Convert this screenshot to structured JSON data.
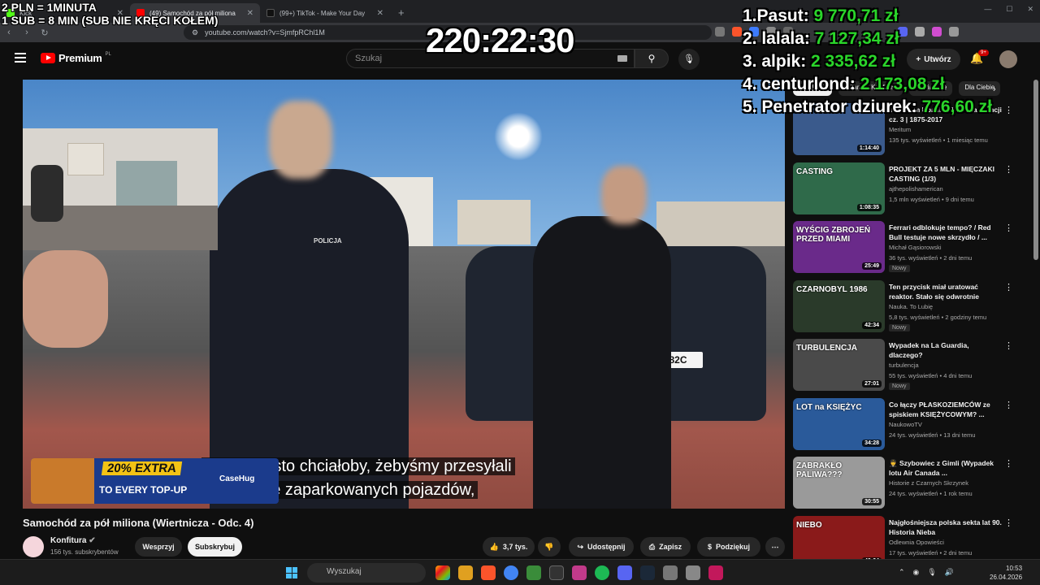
{
  "browser": {
    "tabs": [
      {
        "label": "Kick",
        "active": false
      },
      {
        "label": "(49) Samochód za pół miliona",
        "active": true
      },
      {
        "label": "(99+) TikTok - Make Your Day",
        "active": false
      }
    ],
    "url": "youtube.com/watch?v=SjmfpRChl1M"
  },
  "youtube": {
    "logo": "Premium",
    "logo_region": "PL",
    "search_placeholder": "Szukaj",
    "create_label": "Utwórz",
    "notif_count": "9+"
  },
  "video": {
    "title": "Samochód za pół miliona (Wiertnicza - Odc. 4)",
    "subtitle_line1": "Bo to miasto chciałoby, żebyśmy przesyłali",
    "subtitle_line2": "zdjęcia źle zaparkowanych pojazdów,",
    "car_plate": "T 3182C",
    "police_text": "POLICJA",
    "ad": {
      "headline": "20% EXTRA",
      "line2": "TO EVERY TOP-UP",
      "brand": "CaseHug"
    }
  },
  "channel": {
    "name": "Konfitura",
    "subs": "156 tys. subskrybentów",
    "support_label": "Wesprzyj",
    "subscribe_label": "Subskrybuj"
  },
  "actions": {
    "likes": "3,7 tys.",
    "share": "Udostępnij",
    "save": "Zapisz",
    "thanks": "Podziękuj"
  },
  "chips": [
    "Wszystko",
    "Z kanału Konfitura",
    "Powiązane",
    "Dla Ciebie"
  ],
  "recommendations": [
    {
      "title": "Imperium Upadku: Historia Francji cz. 3 | 1875-2017",
      "channel": "Meritum",
      "meta": "135 tys. wyświetleń • 1 miesiąc temu",
      "duration": "1:14:40",
      "new": "",
      "color": "#3a5a8c"
    },
    {
      "title": "PROJEKT ZA 5 MLN - MIĘCZAKI CASTING (1/3)",
      "channel": "ajthepolishamerican",
      "meta": "1,5 mln wyświetleń • 9 dni temu",
      "duration": "1:08:35",
      "new": "",
      "thumb_text": "CASTING",
      "color": "#2f6a4a"
    },
    {
      "title": "Ferrari odblokuje tempo? / Red Bull testuje nowe skrzydło / ...",
      "channel": "Michał Gąsiorowski",
      "meta": "36 tys. wyświetleń • 2 dni temu",
      "duration": "25:49",
      "new": "Nowy",
      "thumb_text": "WYŚCIG ZBROJEŃ PRZED MIAMI",
      "color": "#6a2a8a"
    },
    {
      "title": "Ten przycisk miał uratować reaktor. Stało się odwrotnie",
      "channel": "Nauka. To Lubię",
      "meta": "5,8 tys. wyświetleń • 2 godziny temu",
      "duration": "42:34",
      "new": "Nowy",
      "thumb_text": "CZARNOBYL 1986",
      "color": "#2a3a2a"
    },
    {
      "title": "Wypadek na La Guardia, dlaczego?",
      "channel": "turbulencja",
      "meta": "55 tys. wyświetleń • 4 dni temu",
      "duration": "27:01",
      "new": "Nowy",
      "thumb_text": "TURBULENCJA",
      "color": "#4a4a4a"
    },
    {
      "title": "Co łączy PŁASKOZIEMCÓW ze spiskiem KSIĘŻYCOWYM? ...",
      "channel": "NaukowoTV",
      "meta": "24 tys. wyświetleń • 13 dni temu",
      "duration": "34:28",
      "new": "",
      "thumb_text": "LOT na KSIĘŻYC",
      "color": "#2a5a9a"
    },
    {
      "title": "🧑‍✈️ Szybowiec z Gimli (Wypadek lotu Air Canada ...",
      "channel": "Historie z Czarnych Skrzynek",
      "meta": "24 tys. wyświetleń • 1 rok temu",
      "duration": "30:55",
      "new": "",
      "thumb_text": "ZABRAKŁO PALIWA???",
      "color": "#9a9a9a"
    },
    {
      "title": "Najgłośniejsza polska sekta lat 90. Historia Nieba",
      "channel": "Odlewnia Opowieści",
      "meta": "17 tys. wyświetleń • 2 dni temu",
      "duration": "49:24",
      "new": "Nowy",
      "thumb_text": "NIEBO",
      "color": "#8a1a1a"
    }
  ],
  "overlay": {
    "rate1": "2 PLN =  1MINUTA",
    "rate2": "1 SUB = 8 MIN (SUB NIE KRĘCI KOŁEM)",
    "timer": "220:22:30",
    "ranking": [
      {
        "name": "1.Pasut:",
        "amount": "9 770,71 zł"
      },
      {
        "name": "2. lalala:",
        "amount": "7 127,34 zł"
      },
      {
        "name": "3. alpik:",
        "amount": "2 335,62 zł"
      },
      {
        "name": "4. centurlond:",
        "amount": "2 173,08 zł"
      },
      {
        "name": "5. Penetrator dziurek:",
        "amount": "776,60 zł"
      }
    ]
  },
  "taskbar": {
    "search_placeholder": "Wyszukaj",
    "time": "10:53",
    "date": "26.04.2026"
  }
}
